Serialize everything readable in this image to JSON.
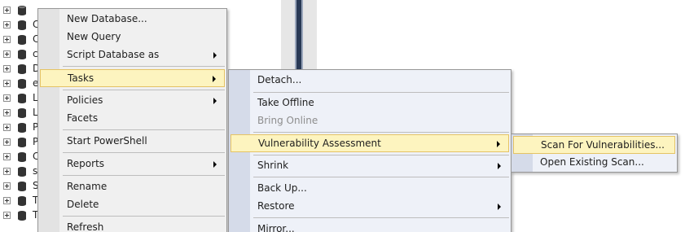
{
  "tree": {
    "selected_label": "",
    "items": [
      {
        "label": ""
      },
      {
        "label": "C"
      },
      {
        "label": "C"
      },
      {
        "label": "c"
      },
      {
        "label": "D"
      },
      {
        "label": "e"
      },
      {
        "label": "L"
      },
      {
        "label": "L"
      },
      {
        "label": "P"
      },
      {
        "label": "P"
      },
      {
        "label": "C"
      },
      {
        "label": "s"
      },
      {
        "label": "S"
      },
      {
        "label": "T"
      },
      {
        "label": "T"
      }
    ]
  },
  "context_menu": {
    "items": [
      {
        "label": "New Database..."
      },
      {
        "label": "New Query"
      },
      {
        "label": "Script Database as"
      },
      {
        "label": "Tasks"
      },
      {
        "label": "Policies"
      },
      {
        "label": "Facets"
      },
      {
        "label": "Start PowerShell"
      },
      {
        "label": "Reports"
      },
      {
        "label": "Rename"
      },
      {
        "label": "Delete"
      },
      {
        "label": "Refresh"
      }
    ]
  },
  "tasks_menu": {
    "items": [
      {
        "label": "Detach..."
      },
      {
        "label": "Take Offline"
      },
      {
        "label": "Bring Online"
      },
      {
        "label": "Vulnerability Assessment"
      },
      {
        "label": "Shrink"
      },
      {
        "label": "Back Up..."
      },
      {
        "label": "Restore"
      },
      {
        "label": "Mirror..."
      }
    ]
  },
  "va_menu": {
    "items": [
      {
        "label": "Scan For Vulnerabilities..."
      },
      {
        "label": "Open Existing Scan..."
      }
    ]
  }
}
